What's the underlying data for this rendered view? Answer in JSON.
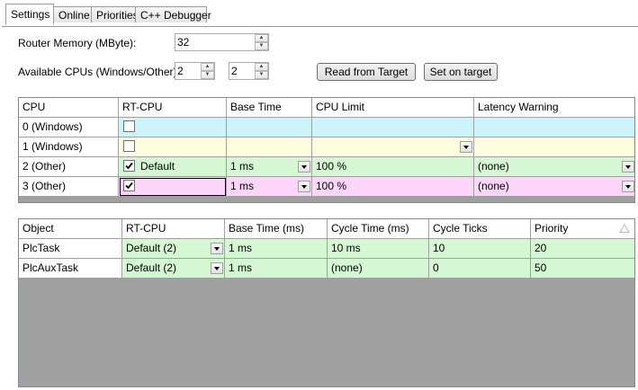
{
  "tabs": [
    "Settings",
    "Online",
    "Priorities",
    "C++ Debugger"
  ],
  "settings": {
    "router_memory_label": "Router Memory (MByte):",
    "router_memory_value": "32",
    "available_cpus_label": "Available CPUs (Windows/Other):",
    "cpus_total": "2",
    "cpus_other": "2",
    "read_button": "Read from Target",
    "set_button": "Set on target"
  },
  "cpu_table": {
    "headers": [
      "CPU",
      "RT-CPU",
      "Base Time",
      "CPU Limit",
      "Latency Warning"
    ],
    "rows": [
      {
        "cpu": "0 (Windows)",
        "checked": false,
        "rt": "",
        "base": "",
        "limit": "",
        "latency": ""
      },
      {
        "cpu": "1 (Windows)",
        "checked": false,
        "rt": "",
        "base": "",
        "limit": "",
        "latency": ""
      },
      {
        "cpu": "2 (Other)",
        "checked": true,
        "rt": "Default",
        "base": "1 ms",
        "limit": "100 %",
        "latency": "(none)"
      },
      {
        "cpu": "3 (Other)",
        "checked": true,
        "rt": "",
        "base": "1 ms",
        "limit": "100 %",
        "latency": "(none)"
      }
    ]
  },
  "task_table": {
    "headers": [
      "Object",
      "RT-CPU",
      "Base Time (ms)",
      "Cycle Time (ms)",
      "Cycle Ticks",
      "Priority"
    ],
    "rows": [
      {
        "object": "PlcTask",
        "rt": "Default (2)",
        "base": "1 ms",
        "cycle": "10 ms",
        "ticks": "10",
        "priority": "20"
      },
      {
        "object": "PlcAuxTask",
        "rt": "Default (2)",
        "base": "1 ms",
        "cycle": "(none)",
        "ticks": "0",
        "priority": "50"
      }
    ]
  },
  "colors": {
    "windows_row_0": "#ccf5fb",
    "windows_row_1": "#fefde0",
    "other_row": "#d6f7d3",
    "selected_row": "#ffd6fb",
    "grid_background": "#a0a0a0"
  }
}
